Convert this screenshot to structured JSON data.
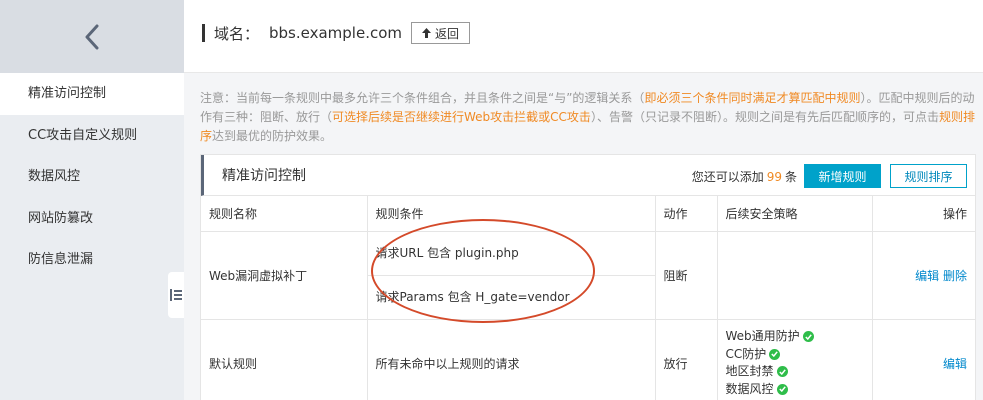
{
  "sidebar": {
    "back_icon": "chevron-left-icon",
    "items": [
      {
        "label": "精准访问控制",
        "active": true
      },
      {
        "label": "CC攻击自定义规则",
        "active": false
      },
      {
        "label": "数据风控",
        "active": false
      },
      {
        "label": "网站防篡改",
        "active": false
      },
      {
        "label": "防信息泄漏",
        "active": false
      }
    ],
    "collapse_icon": "collapse-list-icon"
  },
  "header": {
    "domain_label": "域名：",
    "domain_value": "bbs.example.com",
    "return_label": "返回",
    "return_icon": "return-arrow-icon"
  },
  "notice": {
    "p1": "注意：当前每一条规则中最多允许三个条件组合，并且条件之间是“与”的逻辑关系（",
    "h1": "即必须三个条件同时满足才算匹配中规则",
    "p2": "）。匹配中规则后的动作有三种：阻断、放行（",
    "h2": "可选择后续是否继续进行Web攻击拦截或CC攻击",
    "p3": "）、告警（只记录不阻断）。规则之间是有先后匹配顺序的，可点击",
    "link": "规则排序",
    "p4": "达到最优的防护效果。"
  },
  "panel": {
    "title": "精准访问控制",
    "quota_prefix": "您还可以添加",
    "quota_num": "99",
    "quota_suffix": "条",
    "add_button": "新增规则",
    "sort_button": "规则排序"
  },
  "table": {
    "headers": [
      "规则名称",
      "规则条件",
      "动作",
      "后续安全策略",
      "操作"
    ],
    "rows": [
      {
        "name": "Web漏洞虚拟补丁",
        "conditions": [
          "请求URL 包含 plugin.php",
          "请求Params 包含 H_gate=vendor"
        ],
        "action": "阻断",
        "edit": "编辑",
        "delete": "删除"
      },
      {
        "name": "默认规则",
        "condition": "所有未命中以上规则的请求",
        "action": "放行",
        "policies": [
          "Web通用防护",
          "CC防护",
          "地区封禁",
          "数据风控"
        ],
        "edit": "编辑"
      }
    ]
  },
  "colors": {
    "accent": "#00a2ca",
    "highlight": "#f08a24",
    "annotation": "#d44a2a",
    "check": "#2fbd4a"
  }
}
